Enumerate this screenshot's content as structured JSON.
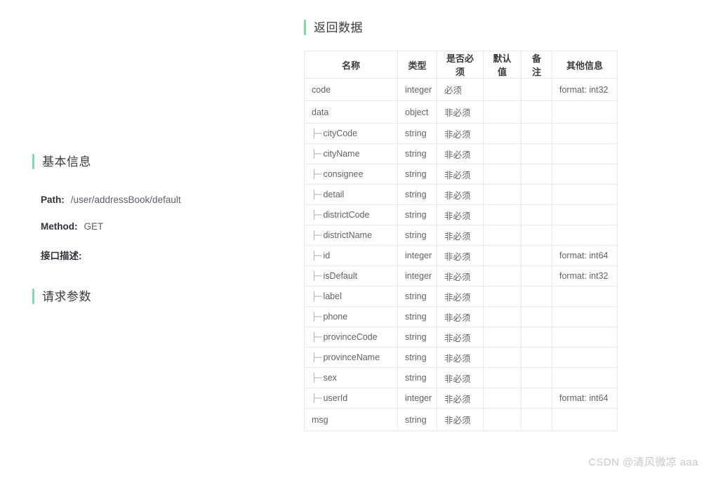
{
  "theme": {
    "accent_color": "#7fd8a6",
    "background": "#ffffff",
    "table_border": "#e8e8e8",
    "text_primary": "#3b3b3b",
    "text_secondary": "#5f6368",
    "watermark_color": "#c9c9c9"
  },
  "left_panel": {
    "basic_info": {
      "title": "基本信息",
      "fields": [
        {
          "key": "Path:",
          "value": "/user/addressBook/default"
        },
        {
          "key": "Method:",
          "value": "GET"
        },
        {
          "key": "接口描述:",
          "value": ""
        }
      ]
    },
    "request_params": {
      "title": "请求参数"
    }
  },
  "right_panel": {
    "return_data": {
      "title": "返回数据",
      "table": {
        "columns": [
          "名称",
          "类型",
          "是否必须",
          "默认值",
          "备注",
          "其他信息"
        ],
        "tree_glyph": "├─",
        "rows": [
          {
            "level": 0,
            "name": "code",
            "type": "integer",
            "required": "必须",
            "default": "",
            "remark": "",
            "extra": "format: int32"
          },
          {
            "level": 0,
            "name": "data",
            "type": "object",
            "required": "非必须",
            "default": "",
            "remark": "",
            "extra": ""
          },
          {
            "level": 1,
            "name": "cityCode",
            "type": "string",
            "required": "非必须",
            "default": "",
            "remark": "",
            "extra": ""
          },
          {
            "level": 1,
            "name": "cityName",
            "type": "string",
            "required": "非必须",
            "default": "",
            "remark": "",
            "extra": ""
          },
          {
            "level": 1,
            "name": "consignee",
            "type": "string",
            "required": "非必须",
            "default": "",
            "remark": "",
            "extra": ""
          },
          {
            "level": 1,
            "name": "detail",
            "type": "string",
            "required": "非必须",
            "default": "",
            "remark": "",
            "extra": ""
          },
          {
            "level": 1,
            "name": "districtCode",
            "type": "string",
            "required": "非必须",
            "default": "",
            "remark": "",
            "extra": ""
          },
          {
            "level": 1,
            "name": "districtName",
            "type": "string",
            "required": "非必须",
            "default": "",
            "remark": "",
            "extra": ""
          },
          {
            "level": 1,
            "name": "id",
            "type": "integer",
            "required": "非必须",
            "default": "",
            "remark": "",
            "extra": "format: int64"
          },
          {
            "level": 1,
            "name": "isDefault",
            "type": "integer",
            "required": "非必须",
            "default": "",
            "remark": "",
            "extra": "format: int32"
          },
          {
            "level": 1,
            "name": "label",
            "type": "string",
            "required": "非必须",
            "default": "",
            "remark": "",
            "extra": ""
          },
          {
            "level": 1,
            "name": "phone",
            "type": "string",
            "required": "非必须",
            "default": "",
            "remark": "",
            "extra": ""
          },
          {
            "level": 1,
            "name": "provinceCode",
            "type": "string",
            "required": "非必须",
            "default": "",
            "remark": "",
            "extra": ""
          },
          {
            "level": 1,
            "name": "provinceName",
            "type": "string",
            "required": "非必须",
            "default": "",
            "remark": "",
            "extra": ""
          },
          {
            "level": 1,
            "name": "sex",
            "type": "string",
            "required": "非必须",
            "default": "",
            "remark": "",
            "extra": ""
          },
          {
            "level": 1,
            "name": "userId",
            "type": "integer",
            "required": "非必须",
            "default": "",
            "remark": "",
            "extra": "format: int64"
          },
          {
            "level": 0,
            "name": "msg",
            "type": "string",
            "required": "非必须",
            "default": "",
            "remark": "",
            "extra": ""
          }
        ]
      }
    }
  },
  "watermark": {
    "text": "CSDN @清风微凉 aaa"
  }
}
